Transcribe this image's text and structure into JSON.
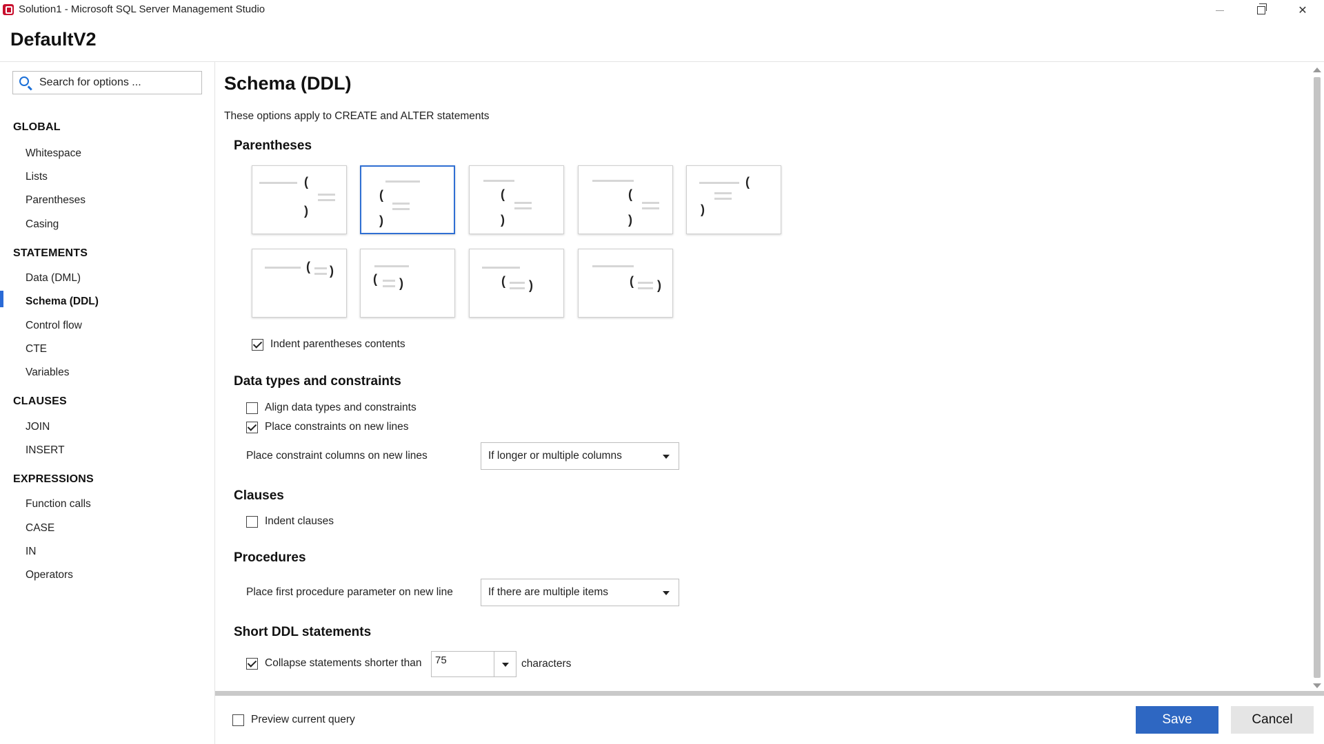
{
  "window": {
    "title": "Solution1 - Microsoft SQL Server Management Studio"
  },
  "header": {
    "title": "DefaultV2"
  },
  "search": {
    "placeholder": "Search for options ..."
  },
  "sidebar": {
    "sections": [
      {
        "label": "GLOBAL",
        "items": [
          "Whitespace",
          "Lists",
          "Parentheses",
          "Casing"
        ]
      },
      {
        "label": "STATEMENTS",
        "items": [
          "Data (DML)",
          "Schema (DDL)",
          "Control flow",
          "CTE",
          "Variables"
        ]
      },
      {
        "label": "CLAUSES",
        "items": [
          "JOIN",
          "INSERT"
        ]
      },
      {
        "label": "EXPRESSIONS",
        "items": [
          "Function calls",
          "CASE",
          "IN",
          "Operators"
        ]
      }
    ],
    "active_item": "Schema (DDL)"
  },
  "main": {
    "title": "Schema (DDL)",
    "description": "These options apply to CREATE and ALTER statements",
    "parentheses": {
      "heading": "Parentheses",
      "selected_style_index": 1,
      "indent_label": "Indent parentheses contents",
      "indent_checked": true
    },
    "data_types": {
      "heading": "Data types and constraints",
      "align_label": "Align data types and constraints",
      "align_checked": false,
      "newlines_label": "Place constraints on new lines",
      "newlines_checked": true,
      "columns_label": "Place constraint columns on new lines",
      "columns_value": "If longer or multiple columns"
    },
    "clauses": {
      "heading": "Clauses",
      "indent_label": "Indent clauses",
      "indent_checked": false
    },
    "procedures": {
      "heading": "Procedures",
      "param_label": "Place first procedure parameter on new line",
      "param_value": "If there are multiple items"
    },
    "short_ddl": {
      "heading": "Short DDL statements",
      "collapse_label": "Collapse statements shorter than",
      "collapse_checked": true,
      "collapse_value": "75",
      "suffix": "characters"
    }
  },
  "footer": {
    "preview_label": "Preview current query",
    "preview_checked": false,
    "save_label": "Save",
    "cancel_label": "Cancel"
  },
  "colors": {
    "accent": "#2e67c2",
    "active_bar": "#2a6ad6",
    "selected_tile": "#2f6fd3"
  }
}
